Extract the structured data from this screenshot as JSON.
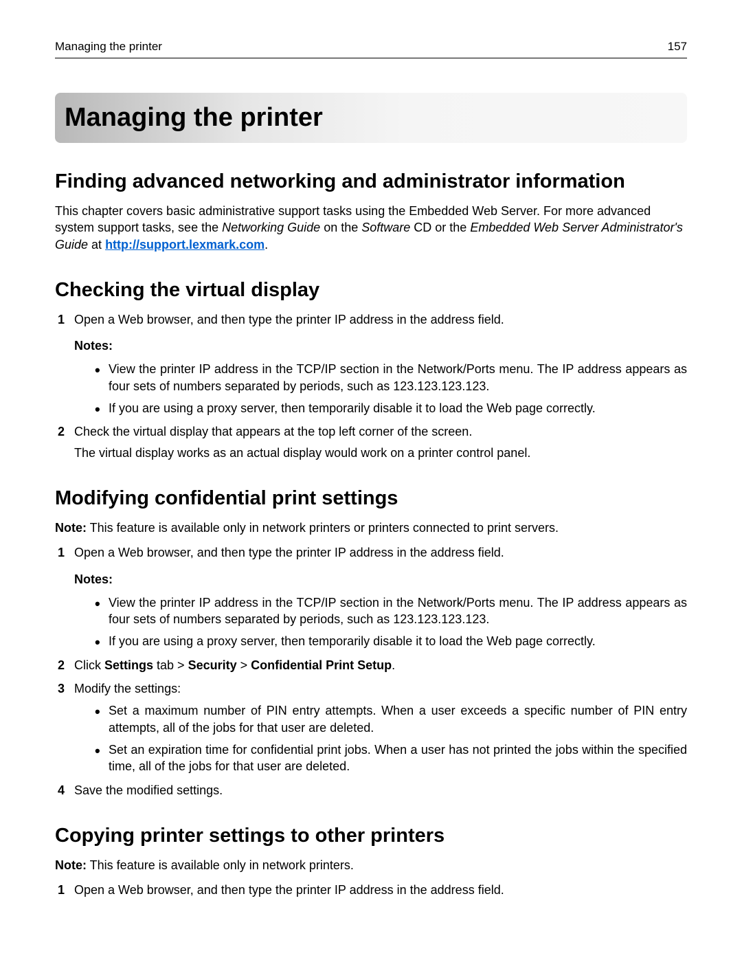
{
  "header": {
    "left": "Managing the printer",
    "right": "157"
  },
  "chapter_title": "Managing the printer",
  "s1": {
    "h2": "Finding advanced networking and administrator information",
    "p1a": "This chapter covers basic administrative support tasks using the Embedded Web Server. For more advanced system support tasks, see the ",
    "p1b_em": "Networking Guide",
    "p1c": " on the ",
    "p1d_em": "Software",
    "p1e": " CD or the ",
    "p1f_em": "Embedded Web Server Administrator's Guide",
    "p1g": " at ",
    "link": "http://support.lexmark.com",
    "p1h": "."
  },
  "s2": {
    "h2": "Checking the virtual display",
    "step1": "Open a Web browser, and then type the printer IP address in the address field.",
    "notes_label": "Notes:",
    "note1": "View the printer IP address in the TCP/IP section in the Network/Ports menu. The IP address appears as four sets of numbers separated by periods, such as 123.123.123.123.",
    "note2": "If you are using a proxy server, then temporarily disable it to load the Web page correctly.",
    "step2": "Check the virtual display that appears at the top left corner of the screen.",
    "step2b": "The virtual display works as an actual display would work on a printer control panel."
  },
  "s3": {
    "h2": "Modifying confidential print settings",
    "note_label": "Note:",
    "note_text": " This feature is available only in network printers or printers connected to print servers.",
    "step1": "Open a Web browser, and then type the printer IP address in the address field.",
    "notes_label": "Notes:",
    "note1": "View the printer IP address in the TCP/IP section in the Network/Ports menu. The IP address appears as four sets of numbers separated by periods, such as 123.123.123.123.",
    "note2": "If you are using a proxy server, then temporarily disable it to load the Web page correctly.",
    "step2a": "Click ",
    "step2b": "Settings",
    "step2c": " tab > ",
    "step2d": "Security",
    "step2e": " > ",
    "step2f": "Confidential Print Setup",
    "step2g": ".",
    "step3": "Modify the settings:",
    "bul1": "Set a maximum number of PIN entry attempts. When a user exceeds a specific number of PIN entry attempts, all of the jobs for that user are deleted.",
    "bul2": "Set an expiration time for confidential print jobs. When a user has not printed the jobs within the specified time, all of the jobs for that user are deleted.",
    "step4": "Save the modified settings."
  },
  "s4": {
    "h2": "Copying printer settings to other printers",
    "note_label": "Note:",
    "note_text": " This feature is available only in network printers.",
    "step1": "Open a Web browser, and then type the printer IP address in the address field."
  }
}
